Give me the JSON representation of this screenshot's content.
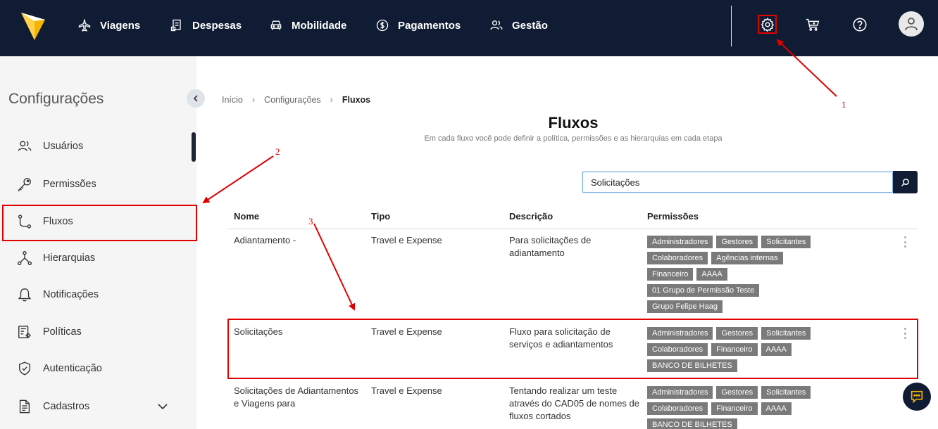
{
  "topbar": {
    "nav": [
      {
        "label": "Viagens",
        "icon": "plane-icon"
      },
      {
        "label": "Despesas",
        "icon": "receipt-icon"
      },
      {
        "label": "Mobilidade",
        "icon": "car-icon"
      },
      {
        "label": "Pagamentos",
        "icon": "dollar-icon"
      },
      {
        "label": "Gestão",
        "icon": "users-icon"
      }
    ],
    "icons": [
      "gear-icon",
      "cart-icon",
      "help-icon",
      "user-icon"
    ],
    "background": "#101c33"
  },
  "sidebar": {
    "title": "Configurações",
    "items": [
      {
        "label": "Usuários",
        "icon": "users-icon"
      },
      {
        "label": "Permissões",
        "icon": "key-icon"
      },
      {
        "label": "Fluxos",
        "icon": "flow-icon",
        "active": true
      },
      {
        "label": "Hierarquias",
        "icon": "hierarchy-icon"
      },
      {
        "label": "Notificações",
        "icon": "bell-icon"
      },
      {
        "label": "Políticas",
        "icon": "policy-icon"
      },
      {
        "label": "Autenticação",
        "icon": "shield-icon"
      },
      {
        "label": "Cadastros",
        "icon": "document-icon"
      }
    ]
  },
  "breadcrumb": [
    "Início",
    "Configurações",
    "Fluxos"
  ],
  "page": {
    "title": "Fluxos",
    "subtitle": "Em cada fluxo você pode definir a política, permissões e as hierarquias em cada etapa"
  },
  "search": {
    "value": "Solicitações"
  },
  "table": {
    "headers": [
      "Nome",
      "Tipo",
      "Descrição",
      "Permissões"
    ],
    "rows": [
      {
        "nome": "Adiantamento -",
        "tipo": "Travel e Expense",
        "descricao": "Para solicitações de adiantamento",
        "permissoes": [
          "Administradores",
          "Gestores",
          "Solicitantes",
          "Colaboradores",
          "Agências internas",
          "Financeiro",
          "AAAA",
          "01 Grupo de Permissão Teste",
          "Grupo Felipe Haag"
        ]
      },
      {
        "nome": "Solicitações",
        "tipo": "Travel e Expense",
        "descricao": "Fluxo para solicitação de serviços e adiantamentos",
        "permissoes": [
          "Administradores",
          "Gestores",
          "Solicitantes",
          "Colaboradores",
          "Financeiro",
          "AAAA",
          "BANCO DE BILHETES"
        ]
      },
      {
        "nome": "Solicitações de Adiantamentos e Viagens para",
        "tipo": "Travel e Expense",
        "descricao": "Tentando realizar um teste através do CAD05 de nomes de fluxos cortados",
        "permissoes": [
          "Administradores",
          "Gestores",
          "Solicitantes",
          "Colaboradores",
          "Financeiro",
          "AAAA",
          "BANCO DE BILHETES"
        ]
      }
    ]
  },
  "annotations": [
    "1",
    "2",
    "3"
  ],
  "colors": {
    "annotation": "#e00000",
    "tag": "#7a7a7a",
    "accent": "#f5b400"
  }
}
